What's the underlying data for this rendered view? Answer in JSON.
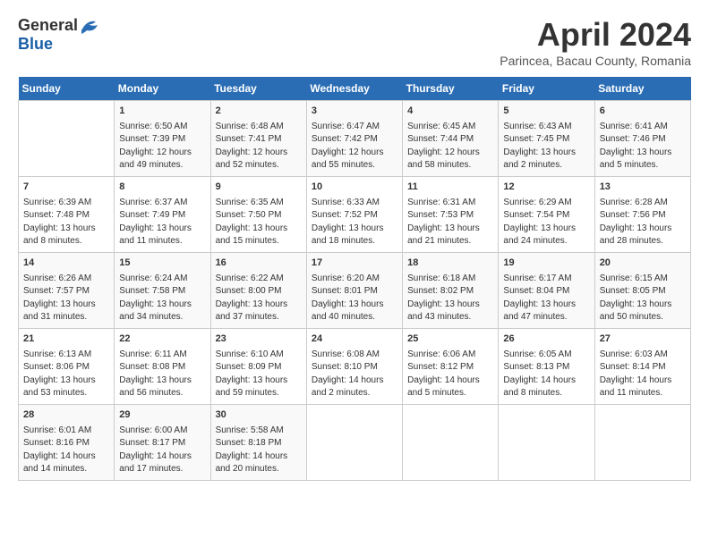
{
  "logo": {
    "general": "General",
    "blue": "Blue"
  },
  "title": "April 2024",
  "subtitle": "Parincea, Bacau County, Romania",
  "days_header": [
    "Sunday",
    "Monday",
    "Tuesday",
    "Wednesday",
    "Thursday",
    "Friday",
    "Saturday"
  ],
  "weeks": [
    [
      {
        "day": "",
        "content": ""
      },
      {
        "day": "1",
        "content": "Sunrise: 6:50 AM\nSunset: 7:39 PM\nDaylight: 12 hours\nand 49 minutes."
      },
      {
        "day": "2",
        "content": "Sunrise: 6:48 AM\nSunset: 7:41 PM\nDaylight: 12 hours\nand 52 minutes."
      },
      {
        "day": "3",
        "content": "Sunrise: 6:47 AM\nSunset: 7:42 PM\nDaylight: 12 hours\nand 55 minutes."
      },
      {
        "day": "4",
        "content": "Sunrise: 6:45 AM\nSunset: 7:44 PM\nDaylight: 12 hours\nand 58 minutes."
      },
      {
        "day": "5",
        "content": "Sunrise: 6:43 AM\nSunset: 7:45 PM\nDaylight: 13 hours\nand 2 minutes."
      },
      {
        "day": "6",
        "content": "Sunrise: 6:41 AM\nSunset: 7:46 PM\nDaylight: 13 hours\nand 5 minutes."
      }
    ],
    [
      {
        "day": "7",
        "content": "Sunrise: 6:39 AM\nSunset: 7:48 PM\nDaylight: 13 hours\nand 8 minutes."
      },
      {
        "day": "8",
        "content": "Sunrise: 6:37 AM\nSunset: 7:49 PM\nDaylight: 13 hours\nand 11 minutes."
      },
      {
        "day": "9",
        "content": "Sunrise: 6:35 AM\nSunset: 7:50 PM\nDaylight: 13 hours\nand 15 minutes."
      },
      {
        "day": "10",
        "content": "Sunrise: 6:33 AM\nSunset: 7:52 PM\nDaylight: 13 hours\nand 18 minutes."
      },
      {
        "day": "11",
        "content": "Sunrise: 6:31 AM\nSunset: 7:53 PM\nDaylight: 13 hours\nand 21 minutes."
      },
      {
        "day": "12",
        "content": "Sunrise: 6:29 AM\nSunset: 7:54 PM\nDaylight: 13 hours\nand 24 minutes."
      },
      {
        "day": "13",
        "content": "Sunrise: 6:28 AM\nSunset: 7:56 PM\nDaylight: 13 hours\nand 28 minutes."
      }
    ],
    [
      {
        "day": "14",
        "content": "Sunrise: 6:26 AM\nSunset: 7:57 PM\nDaylight: 13 hours\nand 31 minutes."
      },
      {
        "day": "15",
        "content": "Sunrise: 6:24 AM\nSunset: 7:58 PM\nDaylight: 13 hours\nand 34 minutes."
      },
      {
        "day": "16",
        "content": "Sunrise: 6:22 AM\nSunset: 8:00 PM\nDaylight: 13 hours\nand 37 minutes."
      },
      {
        "day": "17",
        "content": "Sunrise: 6:20 AM\nSunset: 8:01 PM\nDaylight: 13 hours\nand 40 minutes."
      },
      {
        "day": "18",
        "content": "Sunrise: 6:18 AM\nSunset: 8:02 PM\nDaylight: 13 hours\nand 43 minutes."
      },
      {
        "day": "19",
        "content": "Sunrise: 6:17 AM\nSunset: 8:04 PM\nDaylight: 13 hours\nand 47 minutes."
      },
      {
        "day": "20",
        "content": "Sunrise: 6:15 AM\nSunset: 8:05 PM\nDaylight: 13 hours\nand 50 minutes."
      }
    ],
    [
      {
        "day": "21",
        "content": "Sunrise: 6:13 AM\nSunset: 8:06 PM\nDaylight: 13 hours\nand 53 minutes."
      },
      {
        "day": "22",
        "content": "Sunrise: 6:11 AM\nSunset: 8:08 PM\nDaylight: 13 hours\nand 56 minutes."
      },
      {
        "day": "23",
        "content": "Sunrise: 6:10 AM\nSunset: 8:09 PM\nDaylight: 13 hours\nand 59 minutes."
      },
      {
        "day": "24",
        "content": "Sunrise: 6:08 AM\nSunset: 8:10 PM\nDaylight: 14 hours\nand 2 minutes."
      },
      {
        "day": "25",
        "content": "Sunrise: 6:06 AM\nSunset: 8:12 PM\nDaylight: 14 hours\nand 5 minutes."
      },
      {
        "day": "26",
        "content": "Sunrise: 6:05 AM\nSunset: 8:13 PM\nDaylight: 14 hours\nand 8 minutes."
      },
      {
        "day": "27",
        "content": "Sunrise: 6:03 AM\nSunset: 8:14 PM\nDaylight: 14 hours\nand 11 minutes."
      }
    ],
    [
      {
        "day": "28",
        "content": "Sunrise: 6:01 AM\nSunset: 8:16 PM\nDaylight: 14 hours\nand 14 minutes."
      },
      {
        "day": "29",
        "content": "Sunrise: 6:00 AM\nSunset: 8:17 PM\nDaylight: 14 hours\nand 17 minutes."
      },
      {
        "day": "30",
        "content": "Sunrise: 5:58 AM\nSunset: 8:18 PM\nDaylight: 14 hours\nand 20 minutes."
      },
      {
        "day": "",
        "content": ""
      },
      {
        "day": "",
        "content": ""
      },
      {
        "day": "",
        "content": ""
      },
      {
        "day": "",
        "content": ""
      }
    ]
  ]
}
